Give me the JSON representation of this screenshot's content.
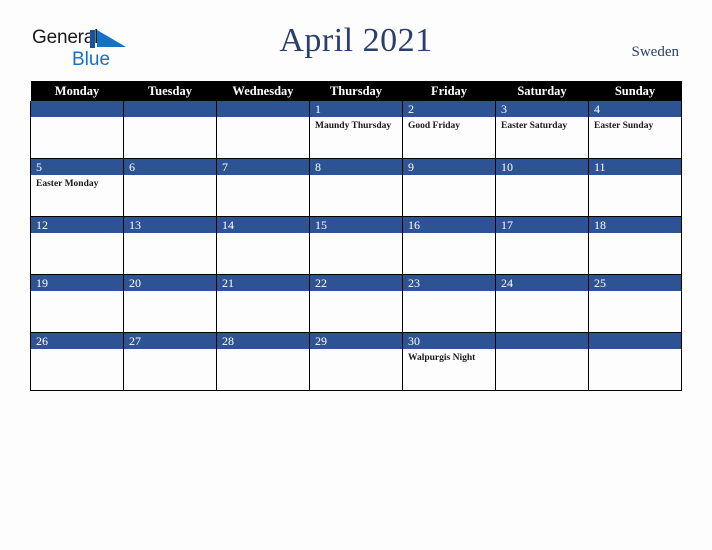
{
  "brand": {
    "word_1": "General",
    "word_2": "Blue",
    "mark": "triangle-logo-icon",
    "accent_color": "#1472c4"
  },
  "header": {
    "title": "April 2021",
    "country": "Sweden",
    "title_color": "#2b3f6c"
  },
  "calendar": {
    "weekday_headers": [
      "Monday",
      "Tuesday",
      "Wednesday",
      "Thursday",
      "Friday",
      "Saturday",
      "Sunday"
    ],
    "header_bg": "#000000",
    "daynum_bg": "#2e5395",
    "weeks": [
      [
        {
          "day": "",
          "holiday": ""
        },
        {
          "day": "",
          "holiday": ""
        },
        {
          "day": "",
          "holiday": ""
        },
        {
          "day": "1",
          "holiday": "Maundy Thursday"
        },
        {
          "day": "2",
          "holiday": "Good Friday"
        },
        {
          "day": "3",
          "holiday": "Easter Saturday"
        },
        {
          "day": "4",
          "holiday": "Easter Sunday"
        }
      ],
      [
        {
          "day": "5",
          "holiday": "Easter Monday"
        },
        {
          "day": "6",
          "holiday": ""
        },
        {
          "day": "7",
          "holiday": ""
        },
        {
          "day": "8",
          "holiday": ""
        },
        {
          "day": "9",
          "holiday": ""
        },
        {
          "day": "10",
          "holiday": ""
        },
        {
          "day": "11",
          "holiday": ""
        }
      ],
      [
        {
          "day": "12",
          "holiday": ""
        },
        {
          "day": "13",
          "holiday": ""
        },
        {
          "day": "14",
          "holiday": ""
        },
        {
          "day": "15",
          "holiday": ""
        },
        {
          "day": "16",
          "holiday": ""
        },
        {
          "day": "17",
          "holiday": ""
        },
        {
          "day": "18",
          "holiday": ""
        }
      ],
      [
        {
          "day": "19",
          "holiday": ""
        },
        {
          "day": "20",
          "holiday": ""
        },
        {
          "day": "21",
          "holiday": ""
        },
        {
          "day": "22",
          "holiday": ""
        },
        {
          "day": "23",
          "holiday": ""
        },
        {
          "day": "24",
          "holiday": ""
        },
        {
          "day": "25",
          "holiday": ""
        }
      ],
      [
        {
          "day": "26",
          "holiday": ""
        },
        {
          "day": "27",
          "holiday": ""
        },
        {
          "day": "28",
          "holiday": ""
        },
        {
          "day": "29",
          "holiday": ""
        },
        {
          "day": "30",
          "holiday": "Walpurgis Night"
        },
        {
          "day": "",
          "holiday": ""
        },
        {
          "day": "",
          "holiday": ""
        }
      ]
    ]
  }
}
